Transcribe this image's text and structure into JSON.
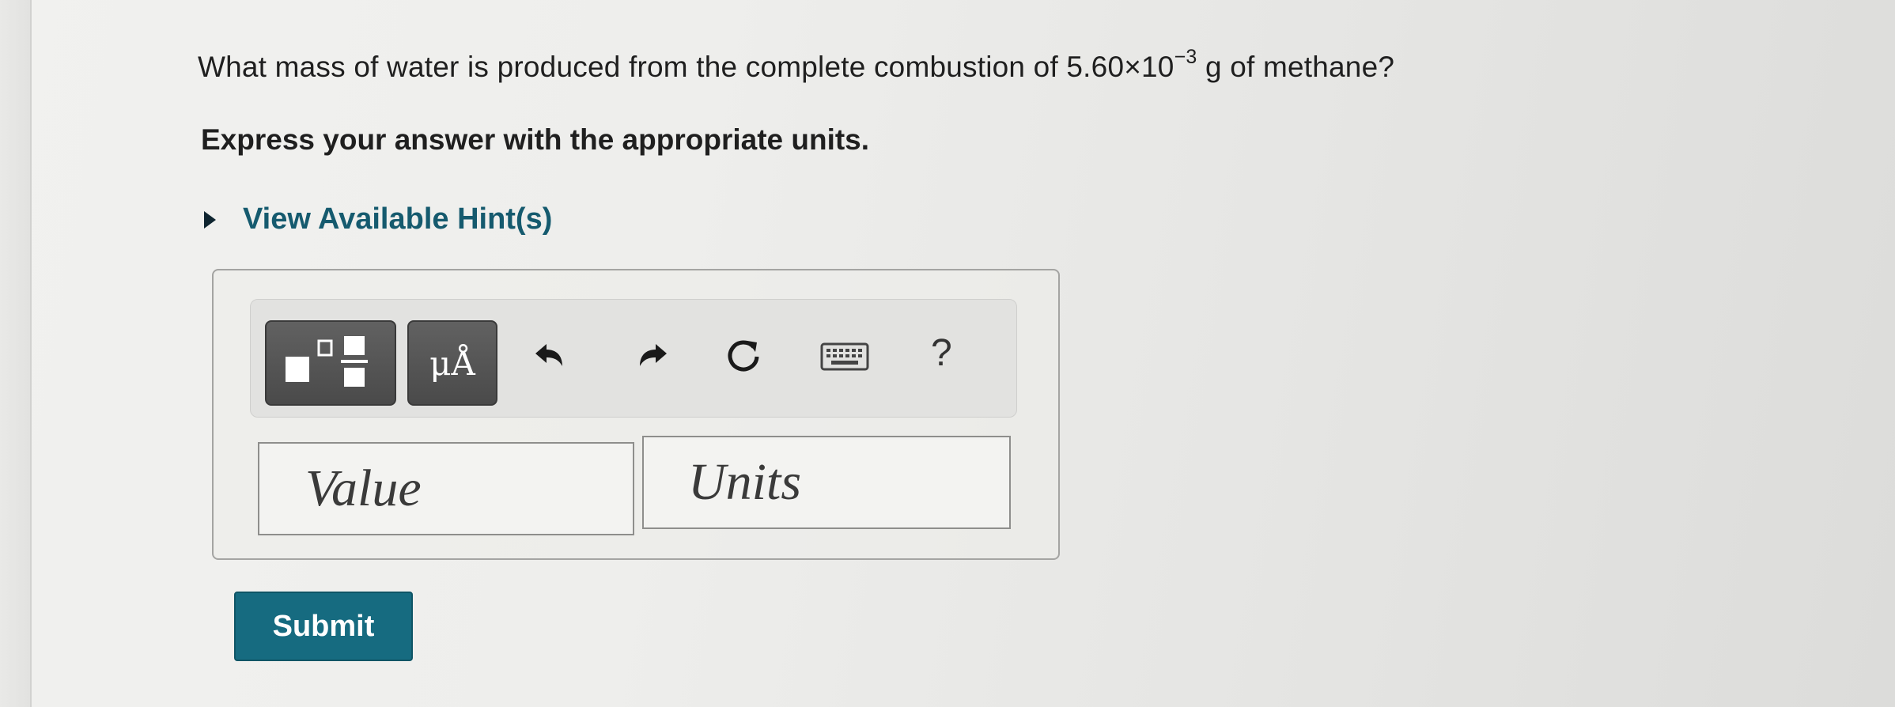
{
  "question": {
    "prefix": "What mass of water is produced from the complete combustion of 5.60×10",
    "exponent": "−3",
    "suffix": " g of methane?"
  },
  "instruction": "Express your answer with the appropriate units.",
  "hint_label": "View Available Hint(s)",
  "toolbar": {
    "units_label": "μÅ",
    "help_label": "?"
  },
  "answer": {
    "value_placeholder": "Value",
    "units_placeholder": "Units"
  },
  "submit_label": "Submit",
  "colors": {
    "accent": "#166b80",
    "link": "#155a6e",
    "toolbar_button": "#555555"
  },
  "icons": [
    "templates-icon",
    "undo-icon",
    "redo-icon",
    "reset-icon",
    "keyboard-icon",
    "help-icon",
    "hint-toggle-icon"
  ]
}
